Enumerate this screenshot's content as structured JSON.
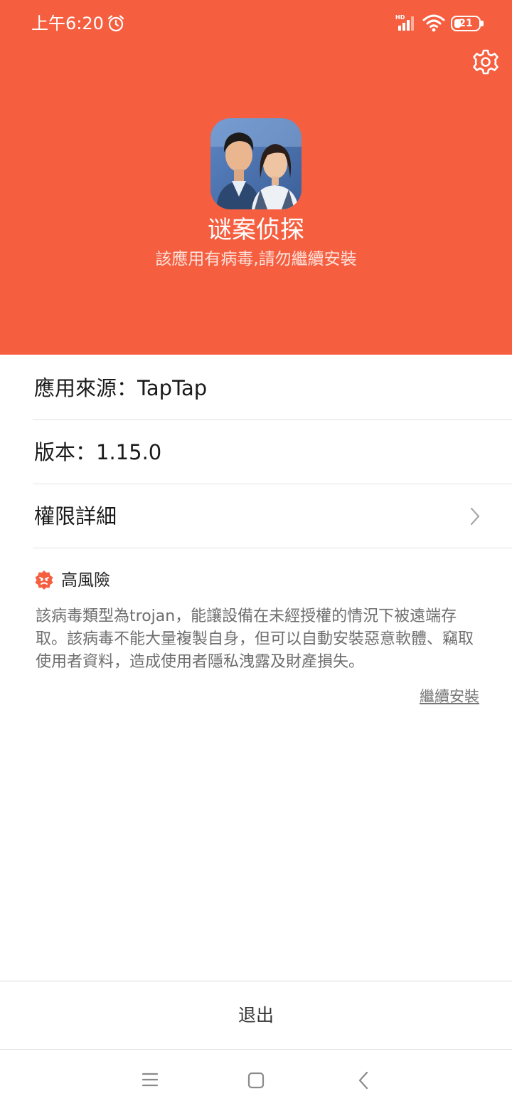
{
  "status_bar": {
    "time": "上午6:20",
    "battery_level": "21",
    "network_label": "HD"
  },
  "header": {
    "app_name": "谜案侦探",
    "warning": "該應用有病毒,請勿繼續安裝",
    "background_color": "#f55f40"
  },
  "info": {
    "source": "應用來源：TapTap",
    "version": "版本：1.15.0",
    "permissions": "權限詳細"
  },
  "risk": {
    "level": "高風險",
    "description": "該病毒類型為trojan，能讓設備在未經授權的情況下被遠端存取。該病毒不能大量複製自身，但可以自動安裝惡意軟體、竊取使用者資料，造成使用者隱私洩露及財產損失。",
    "continue_label": "繼續安裝",
    "icon_color": "#f55f40"
  },
  "footer": {
    "exit_label": "退出"
  }
}
